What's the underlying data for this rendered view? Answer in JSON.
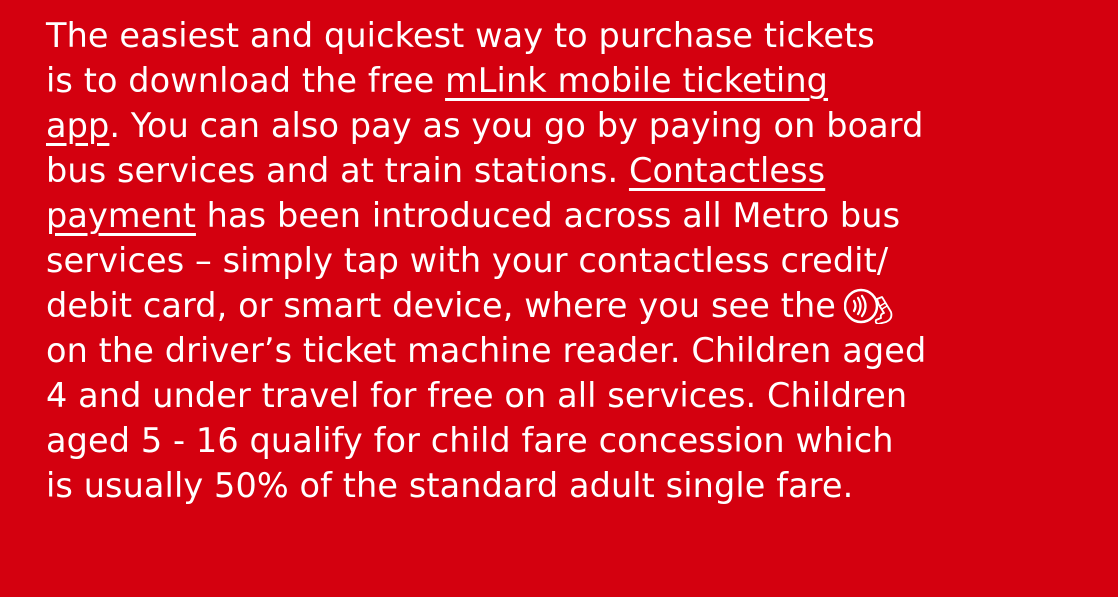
{
  "colors": {
    "background": "#d4000f",
    "text": "#ffffff"
  },
  "paragraph": {
    "line1": "The easiest and quickest way to purchase tickets",
    "line2_prefix": "is to download the free ",
    "mlink_link_part1": "mLink mobile ticketing",
    "mlink_link_part2": "app",
    "line3_suffix": ". You can also pay as you go by paying on board",
    "line4_prefix": "bus services and at train stations. ",
    "contactless_link_part1": "Contactless",
    "contactless_link_part2": "payment",
    "line5_suffix": " has been introduced across all Metro bus",
    "line6": "services – simply tap with your contactless credit/",
    "line7": "debit card, or smart device, where you see the",
    "line8": "on the driver’s ticket machine reader. Children aged",
    "line9": "4 and under travel for free on all services. Children",
    "line10": "aged 5 - 16 qualify for child fare concession which",
    "line11": "is usually 50% of the standard adult single fare."
  },
  "icons": {
    "contactless": "contactless-payment-icon"
  }
}
